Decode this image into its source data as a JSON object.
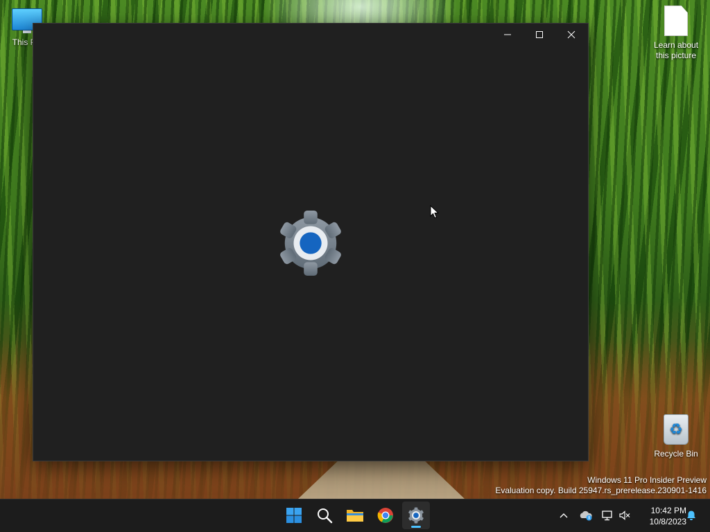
{
  "desktop": {
    "icons": [
      {
        "label": "This PC",
        "icon": "monitor-icon"
      },
      {
        "label": "Learn about\nthis picture",
        "icon": "document-icon"
      },
      {
        "label": "Recycle Bin",
        "icon": "recycle-bin-icon"
      }
    ],
    "watermark": {
      "line1": "Windows 11 Pro Insider Preview",
      "line2": "Evaluation copy. Build 25947.rs_prerelease.230901-1416"
    }
  },
  "window": {
    "app": "Settings",
    "splash_icon": "settings-gear-icon",
    "controls": [
      "minimize",
      "maximize",
      "close"
    ]
  },
  "taskbar": {
    "apps": [
      {
        "name": "Start",
        "icon": "windows-logo-icon"
      },
      {
        "name": "Search",
        "icon": "search-icon"
      },
      {
        "name": "File Explorer",
        "icon": "folder-icon"
      },
      {
        "name": "Google Chrome",
        "icon": "chrome-icon"
      },
      {
        "name": "Settings",
        "icon": "settings-gear-icon",
        "active": true
      }
    ],
    "tray": [
      "chevron-up-icon",
      "onedrive-icon",
      "network-icon",
      "volume-muted-icon"
    ],
    "clock": {
      "time": "10:42 PM",
      "date": "10/8/2023"
    },
    "notification_icon": "bell-icon"
  },
  "colors": {
    "accent": "#4cc2ff",
    "window_bg": "#202020",
    "taskbar_bg": "#1c1c1c",
    "gear_blue": "#1565c0"
  }
}
